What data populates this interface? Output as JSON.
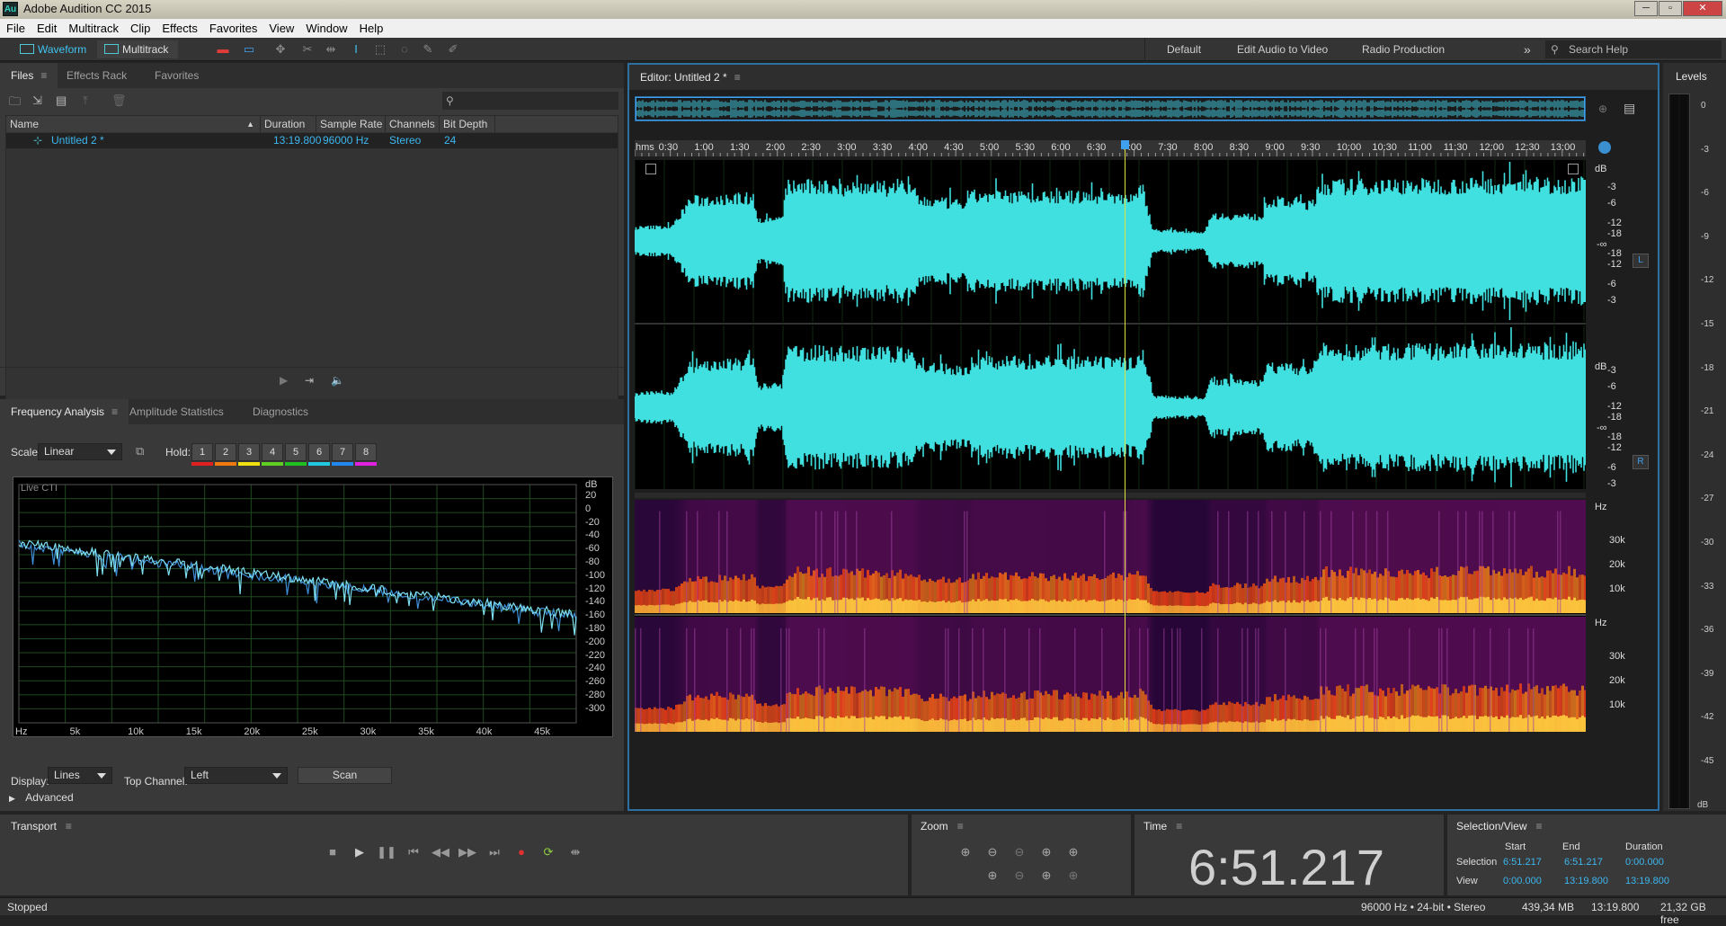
{
  "window": {
    "title": "Adobe Audition CC 2015",
    "app_icon": "Au",
    "buttons": [
      "─",
      "▫",
      "✕"
    ]
  },
  "menu": [
    "File",
    "Edit",
    "Multitrack",
    "Clip",
    "Effects",
    "Favorites",
    "View",
    "Window",
    "Help"
  ],
  "toolbar": {
    "waveform_label": "Waveform",
    "multitrack_label": "Multitrack",
    "workspaces": [
      "Default",
      "Edit Audio to Video",
      "Radio Production"
    ],
    "more": "»",
    "search_placeholder": "Search Help"
  },
  "files_panel": {
    "tabs": [
      "Files",
      "Effects Rack",
      "Favorites"
    ],
    "columns": [
      "Name",
      "Duration",
      "Sample Rate",
      "Channels",
      "Bit Depth"
    ],
    "rows": [
      {
        "name": "Untitled 2 *",
        "duration": "13:19.800",
        "sample_rate": "96000 Hz",
        "channels": "Stereo",
        "bit_depth": "24"
      }
    ]
  },
  "analysis_panel": {
    "tabs": [
      "Frequency Analysis",
      "Amplitude Statistics",
      "Diagnostics"
    ],
    "scale_label": "Scale:",
    "scale_value": "Linear",
    "hold_label": "Hold:",
    "hold_buttons": [
      "1",
      "2",
      "3",
      "4",
      "5",
      "6",
      "7",
      "8"
    ],
    "hold_colors": [
      "#e02020",
      "#f07a10",
      "#f0e010",
      "#60d020",
      "#20c020",
      "#20c8e0",
      "#2088f0",
      "#e020e0"
    ],
    "graph_label": "Live CTI",
    "db_unit": "dB",
    "db_ticks": [
      "20",
      "0",
      "-20",
      "-40",
      "-60",
      "-80",
      "-100",
      "-120",
      "-140",
      "-160",
      "-180",
      "-200",
      "-220",
      "-240",
      "-260",
      "-280",
      "-300"
    ],
    "freq_ticks": [
      "Hz",
      "5k",
      "10k",
      "15k",
      "20k",
      "25k",
      "30k",
      "35k",
      "40k",
      "45k"
    ],
    "display_label": "Display:",
    "display_value": "Lines",
    "top_channel_label": "Top Channel:",
    "top_channel_value": "Left",
    "scan_label": "Scan",
    "advanced_label": "Advanced"
  },
  "editor": {
    "title": "Editor: Untitled 2 *",
    "time_unit": "hms",
    "time_ticks": [
      "0:30",
      "1:00",
      "1:30",
      "2:00",
      "2:30",
      "3:00",
      "3:30",
      "4:00",
      "4:30",
      "5:00",
      "5:30",
      "6:00",
      "6:30",
      "7:00",
      "7:30",
      "8:00",
      "8:30",
      "9:00",
      "9:30",
      "10:00",
      "10:30",
      "11:00",
      "11:30",
      "12:00",
      "12:30",
      "13:00"
    ],
    "db_unit": "dB",
    "db_ticks_left": [
      "-3",
      "-6",
      "-12",
      "-18",
      "-∞",
      "-18",
      "-12",
      "-6",
      "-3"
    ],
    "db_ticks_right": [
      "-3",
      "-6",
      "-12",
      "-18",
      "-∞",
      "-18",
      "-12",
      "-6",
      "-3"
    ],
    "channel_left": "L",
    "channel_right": "R",
    "hz_unit": "Hz",
    "hz_ticks": [
      "30k",
      "20k",
      "10k"
    ],
    "cti_fraction": 0.5147,
    "waveform_color": "#40e0e0"
  },
  "levels_panel": {
    "title": "Levels",
    "ticks": [
      "0",
      "-3",
      "-6",
      "-9",
      "-12",
      "-15",
      "-18",
      "-21",
      "-24",
      "-27",
      "-30",
      "-33",
      "-36",
      "-39",
      "-42",
      "-45",
      "dB"
    ]
  },
  "transport": {
    "title": "Transport"
  },
  "zoom": {
    "title": "Zoom"
  },
  "time_panel": {
    "title": "Time",
    "value": "6:51.217"
  },
  "selection_view": {
    "title": "Selection/View",
    "headers": [
      "Start",
      "End",
      "Duration"
    ],
    "selection_label": "Selection",
    "selection": [
      "6:51.217",
      "6:51.217",
      "0:00.000"
    ],
    "view_label": "View",
    "view": [
      "0:00.000",
      "13:19.800",
      "13:19.800"
    ]
  },
  "status": {
    "state": "Stopped",
    "format": "96000 Hz • 24-bit • Stereo",
    "size": "439,34 MB",
    "duration": "13:19.800",
    "free": "21,32 GB free"
  }
}
